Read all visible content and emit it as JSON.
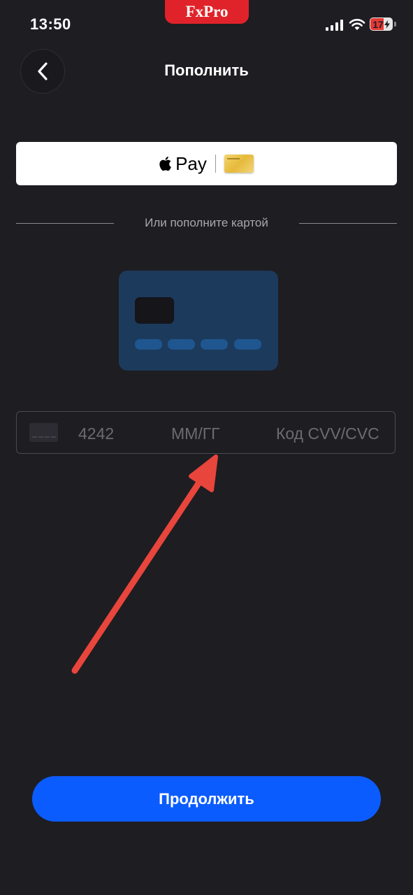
{
  "status_bar": {
    "time": "13:50",
    "battery": "17",
    "brand": "FxPro"
  },
  "header": {
    "title": "Пополнить",
    "back_icon": "chevron-left-icon"
  },
  "apple_pay": {
    "label": "Pay",
    "icon": "apple-icon"
  },
  "divider": {
    "text": "Или пополните картой"
  },
  "card_input": {
    "number_placeholder": "4242",
    "expiry_placeholder": "ММ/ГГ",
    "cvv_placeholder": "Код CVV/CVC"
  },
  "continue_button": {
    "label": "Продолжить"
  },
  "colors": {
    "background": "#1e1d22",
    "accent": "#0b5cff",
    "brand": "#e0232a",
    "annotation_arrow": "#e8453c"
  }
}
